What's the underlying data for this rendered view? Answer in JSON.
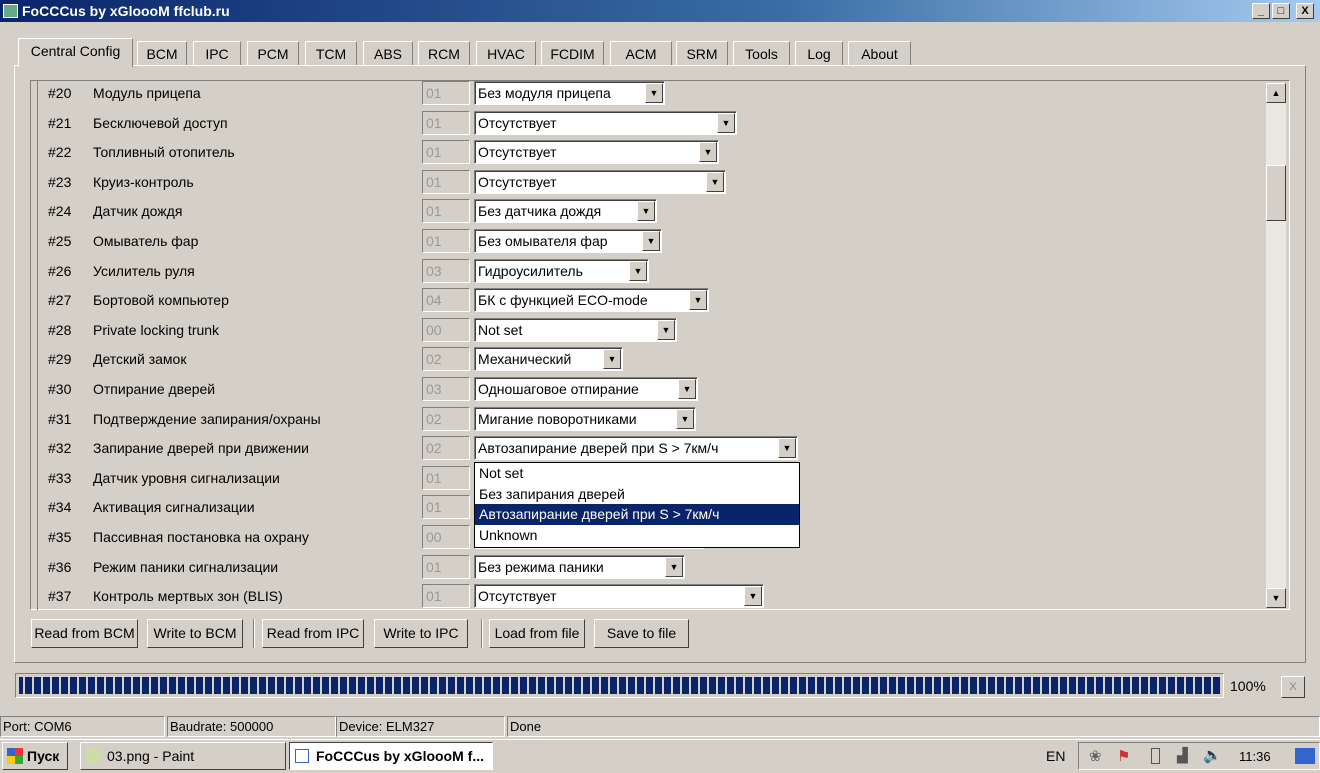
{
  "window": {
    "title": "FoCCCus by xGloooM ffclub.ru",
    "min": "_",
    "max": "□",
    "close": "X"
  },
  "tabs": [
    "Central Config",
    "BCM",
    "IPC",
    "PCM",
    "TCM",
    "ABS",
    "RCM",
    "HVAC",
    "FCDIM",
    "ACM",
    "SRM",
    "Tools",
    "Log",
    "About"
  ],
  "active_tab": "Central Config",
  "rows": [
    {
      "num": "#20",
      "name": "Модуль прицепа",
      "val": "01",
      "sel": "Без модуля прицепа"
    },
    {
      "num": "#21",
      "name": "Бесключевой доступ",
      "val": "01",
      "sel": "Отсутствует"
    },
    {
      "num": "#22",
      "name": "Топливный отопитель",
      "val": "01",
      "sel": "Отсутствует"
    },
    {
      "num": "#23",
      "name": "Круиз-контроль",
      "val": "01",
      "sel": "Отсутствует"
    },
    {
      "num": "#24",
      "name": "Датчик дождя",
      "val": "01",
      "sel": "Без датчика дождя"
    },
    {
      "num": "#25",
      "name": "Омыватель фар",
      "val": "01",
      "sel": "Без омывателя фар"
    },
    {
      "num": "#26",
      "name": "Усилитель руля",
      "val": "03",
      "sel": "Гидроусилитель"
    },
    {
      "num": "#27",
      "name": "Бортовой компьютер",
      "val": "04",
      "sel": "БК с функцией ECO-mode"
    },
    {
      "num": "#28",
      "name": "Private locking trunk",
      "val": "00",
      "sel": "Not set"
    },
    {
      "num": "#29",
      "name": "Детский замок",
      "val": "02",
      "sel": "Механический"
    },
    {
      "num": "#30",
      "name": "Отпирание дверей",
      "val": "03",
      "sel": "Одношаговое отпирание"
    },
    {
      "num": "#31",
      "name": "Подтверждение запирания/охраны",
      "val": "02",
      "sel": "Мигание поворотниками"
    },
    {
      "num": "#32",
      "name": "Запирание дверей при движении",
      "val": "02",
      "sel": "Автозапирание дверей при S > 7км/ч"
    },
    {
      "num": "#33",
      "name": "Датчик уровня сигнализации",
      "val": "01",
      "sel": ""
    },
    {
      "num": "#34",
      "name": "Активация сигнализации",
      "val": "01",
      "sel": ""
    },
    {
      "num": "#35",
      "name": "Пассивная постановка на охрану",
      "val": "00",
      "sel": ""
    },
    {
      "num": "#36",
      "name": "Режим паники сигнализации",
      "val": "01",
      "sel": "Без режима паники"
    },
    {
      "num": "#37",
      "name": "Контроль мертвых зон (BLIS)",
      "val": "01",
      "sel": "Отсутствует"
    }
  ],
  "dropdown_open": {
    "options": [
      "Not set",
      "Без запирания дверей",
      "Автозапирание дверей при S > 7км/ч",
      "Unknown"
    ],
    "selected_index": 2
  },
  "buttons": [
    "Read from BCM",
    "Write to BCM",
    "Read from IPC",
    "Write to IPC",
    "Load from file",
    "Save to file"
  ],
  "progress": {
    "value_percent": 100,
    "label": "100%",
    "cancel": "X"
  },
  "status": [
    "Port: COM6",
    "Baudrate: 500000",
    "Device: ELM327",
    "Done"
  ],
  "taskbar": {
    "start": "Пуск",
    "items": [
      "03.png - Paint",
      "FoCCCus by xGloooM f..."
    ],
    "lang": "EN",
    "clock": "11:36"
  }
}
